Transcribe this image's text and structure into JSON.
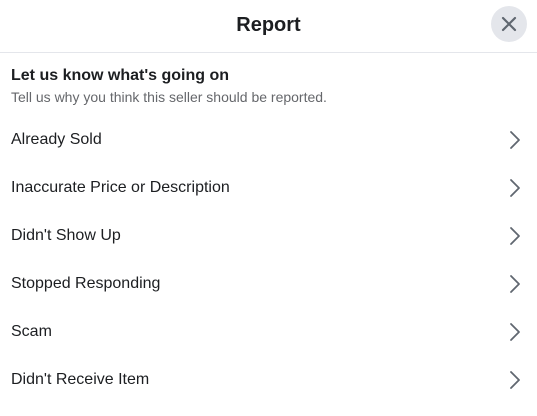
{
  "header": {
    "title": "Report",
    "close_icon": "close-icon"
  },
  "intro": {
    "title": "Let us know what's going on",
    "subtitle": "Tell us why you think this seller should be reported."
  },
  "options": [
    {
      "label": "Already Sold",
      "icon": "chevron-right-icon"
    },
    {
      "label": "Inaccurate Price or Description",
      "icon": "chevron-right-icon"
    },
    {
      "label": "Didn't Show Up",
      "icon": "chevron-right-icon"
    },
    {
      "label": "Stopped Responding",
      "icon": "chevron-right-icon"
    },
    {
      "label": "Scam",
      "icon": "chevron-right-icon"
    },
    {
      "label": "Didn't Receive Item",
      "icon": "chevron-right-icon"
    }
  ]
}
